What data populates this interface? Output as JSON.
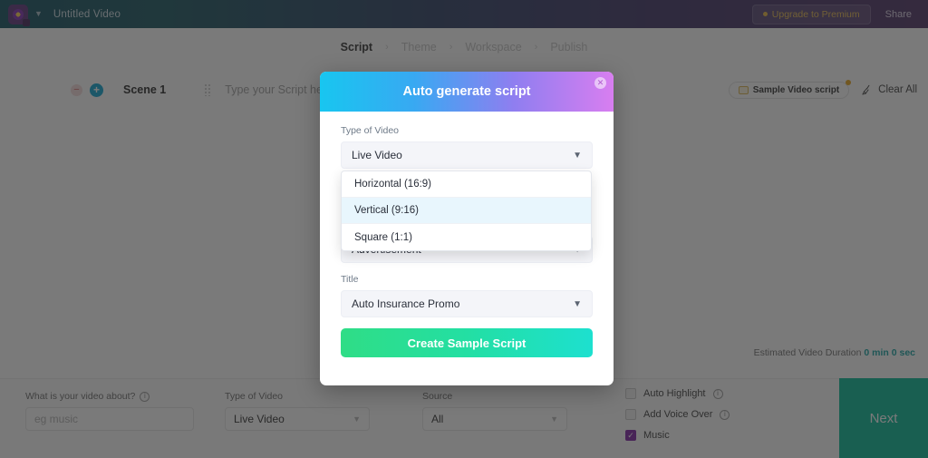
{
  "topbar": {
    "logo_icon": "app-logo-icon",
    "caret_icon": "chevron-down-icon",
    "doc_title": "Untitled Video",
    "upgrade_label": "Upgrade to Premium",
    "share_label": "Share",
    "gradient_from": "#0d4d5c",
    "gradient_to": "#4b2d63"
  },
  "breadcrumb": {
    "separator": "›",
    "steps": [
      {
        "label": "Script",
        "active": true
      },
      {
        "label": "Theme",
        "active": false
      },
      {
        "label": "Workspace",
        "active": false
      },
      {
        "label": "Publish",
        "active": false
      }
    ]
  },
  "scene_toolbar": {
    "remove_icon": "minus-icon",
    "add_icon": "plus-icon",
    "scene_label": "Scene 1",
    "drag_icon": "drag-handle-icon",
    "script_placeholder": "Type your Script here",
    "sample_button": "Sample Video script",
    "sample_icon": "note-icon",
    "clear_all": "Clear All",
    "broom_icon": "broom-icon"
  },
  "duration": {
    "prefix": "Estimated Video Duration",
    "value": "0 min 0 sec",
    "value_color": "#12a0a0"
  },
  "bottom_panel": {
    "about": {
      "label": "What is your video about?",
      "info_icon": "info-icon",
      "placeholder": "eg music",
      "value": ""
    },
    "type_of_video": {
      "label": "Type of Video",
      "value": "Live Video",
      "caret_icon": "chevron-down-icon"
    },
    "source": {
      "label": "Source",
      "value": "All",
      "caret_icon": "chevron-down-icon"
    },
    "checkboxes": [
      {
        "label": "Auto Highlight",
        "checked": false,
        "info_icon": "info-icon"
      },
      {
        "label": "Add Voice Over",
        "checked": false,
        "info_icon": "info-icon"
      },
      {
        "label": "Music",
        "checked": true,
        "info_icon": ""
      }
    ],
    "checked_color": "#7b1fa2",
    "next_label": "Next",
    "next_color": "#00b894"
  },
  "modal": {
    "title": "Auto generate script",
    "close_icon": "close-icon",
    "header_gradient_from": "#18c6f0",
    "header_gradient_to": "#d87ef0",
    "fields": [
      {
        "label": "Type of Video",
        "value": "Live Video",
        "caret_icon": "chevron-down-icon"
      },
      {
        "label": "",
        "value": "Advertisement",
        "caret_icon": "chevron-down-icon"
      },
      {
        "label": "Title",
        "value": "Auto Insurance Promo",
        "caret_icon": "chevron-down-icon"
      }
    ],
    "cta_label": "Create Sample Script",
    "cta_gradient_from": "#2fdd86",
    "cta_gradient_to": "#1de0cf",
    "open_dropdown": {
      "options": [
        {
          "label": "Horizontal (16:9)",
          "selected": false
        },
        {
          "label": "Vertical (9:16)",
          "selected": true
        },
        {
          "label": "Square (1:1)",
          "selected": false
        }
      ],
      "highlight_color": "#e8f6fd"
    }
  }
}
